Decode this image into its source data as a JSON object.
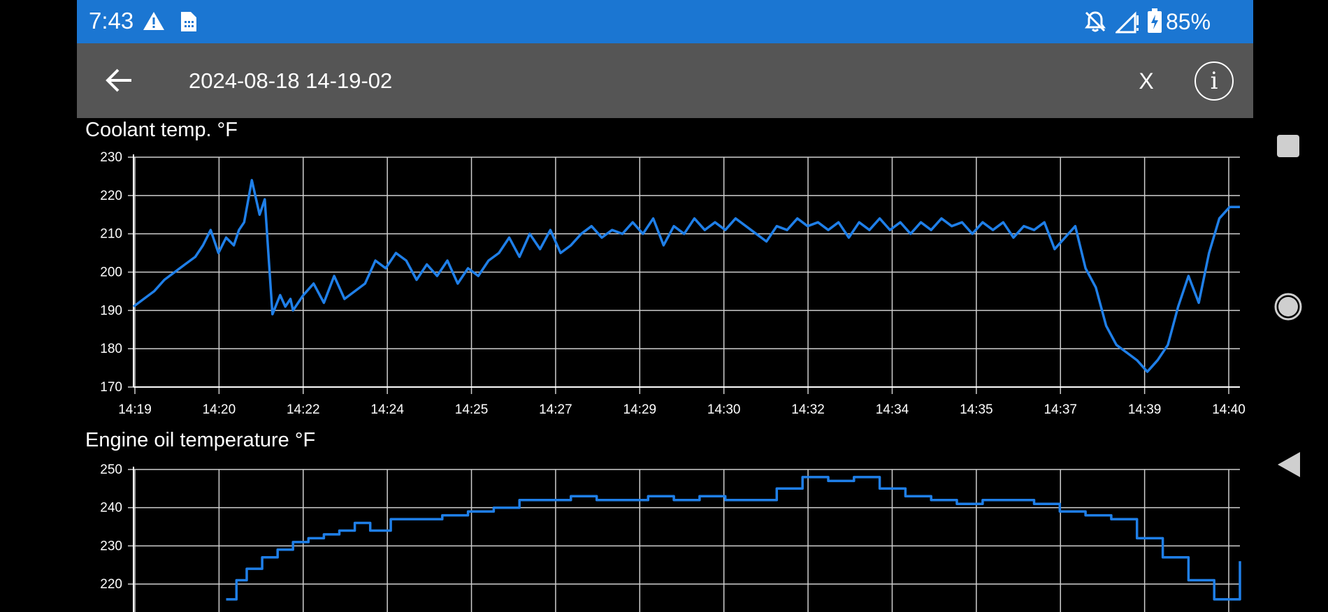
{
  "status_bar": {
    "time": "7:43",
    "battery_percent": "85%",
    "background_color": "#1b76d2",
    "icons": [
      "warning-icon",
      "sim-card-icon",
      "notifications-off-icon",
      "signal-no-data-icon",
      "battery-charging-icon"
    ]
  },
  "toolbar": {
    "title": "2024-08-18 14-19-02",
    "close_label": "X",
    "info_label": "i",
    "background_color": "#555555",
    "icons": [
      "back-arrow-icon",
      "info-icon"
    ]
  },
  "navigation_bar": {
    "icons": [
      "recents-square-icon",
      "home-circle-icon",
      "back-triangle-icon"
    ]
  },
  "charts": [
    {
      "title": "Coolant temp.  °F",
      "x_ticks": [
        "14:19",
        "14:20",
        "14:22",
        "14:24",
        "14:25",
        "14:27",
        "14:29",
        "14:30",
        "14:32",
        "14:34",
        "14:35",
        "14:37",
        "14:39",
        "14:40"
      ],
      "y_ticks": [
        "230",
        "220",
        "210",
        "200",
        "190",
        "180",
        "170"
      ]
    },
    {
      "title": "Engine oil temperature  °F",
      "y_ticks": [
        "250",
        "240",
        "230",
        "220"
      ]
    }
  ],
  "chart_data": [
    {
      "type": "line",
      "title": "Coolant temp.  °F",
      "xlabel": "",
      "ylabel": "",
      "x_unit": "minutes",
      "xlim": [
        0,
        21.5
      ],
      "ylim": [
        170,
        230
      ],
      "grid": true,
      "line_color": "#1f7fe8",
      "series": [
        {
          "x": [
            0.0,
            0.2,
            0.4,
            0.6,
            0.8,
            1.0,
            1.2,
            1.35,
            1.5,
            1.65,
            1.8,
            1.95,
            2.05,
            2.15,
            2.3,
            2.45,
            2.55,
            2.7,
            2.85,
            2.95,
            3.05,
            3.1,
            3.15,
            3.3,
            3.5,
            3.7,
            3.9,
            4.1,
            4.3,
            4.5,
            4.7,
            4.9,
            5.1,
            5.3,
            5.5,
            5.7,
            5.9,
            6.1,
            6.3,
            6.5,
            6.7,
            6.9,
            7.1,
            7.3,
            7.5,
            7.7,
            7.9,
            8.1,
            8.3,
            8.5,
            8.7,
            8.9,
            9.1,
            9.3,
            9.5,
            9.7,
            9.9,
            10.1,
            10.3,
            10.5,
            10.7,
            10.9,
            11.1,
            11.3,
            11.5,
            11.7,
            11.9,
            12.1,
            12.3,
            12.5,
            12.7,
            12.9,
            13.1,
            13.3,
            13.5,
            13.7,
            13.9,
            14.1,
            14.3,
            14.5,
            14.7,
            14.9,
            15.1,
            15.3,
            15.5,
            15.7,
            15.9,
            16.1,
            16.3,
            16.5,
            16.7,
            16.9,
            17.1,
            17.3,
            17.5,
            17.7,
            17.9,
            18.1,
            18.3,
            18.5,
            18.7,
            18.9,
            19.1,
            19.3,
            19.5,
            19.7,
            19.9,
            20.1,
            20.3,
            20.5,
            20.7,
            20.9,
            21.1,
            21.3,
            21.5
          ],
          "y": [
            191,
            193,
            195,
            198,
            200,
            202,
            204,
            207,
            211,
            205,
            209,
            207,
            211,
            213,
            224,
            215,
            219,
            189,
            194,
            191,
            193,
            190,
            191,
            194,
            197,
            192,
            199,
            193,
            195,
            197,
            203,
            201,
            205,
            203,
            198,
            202,
            199,
            203,
            197,
            201,
            199,
            203,
            205,
            209,
            204,
            210,
            206,
            211,
            205,
            207,
            210,
            212,
            209,
            211,
            210,
            213,
            210,
            214,
            207,
            212,
            210,
            214,
            211,
            213,
            211,
            214,
            212,
            210,
            208,
            212,
            211,
            214,
            212,
            213,
            211,
            213,
            209,
            213,
            211,
            214,
            211,
            213,
            210,
            213,
            211,
            214,
            212,
            213,
            210,
            213,
            211,
            213,
            209,
            212,
            211,
            213,
            206,
            209,
            212,
            201,
            196,
            186,
            181,
            179,
            177,
            174,
            177,
            181,
            191,
            199,
            192,
            205,
            214,
            217,
            217
          ],
          "values_note": "approximate"
        }
      ]
    },
    {
      "type": "line",
      "title": "Engine oil temperature  °F",
      "xlabel": "",
      "ylabel": "",
      "ylim": [
        215,
        250
      ],
      "grid": true,
      "line_color": "#1f7fe8",
      "series": [
        {
          "x": [
            1.8,
            2.0,
            2.2,
            2.5,
            2.8,
            3.1,
            3.4,
            3.7,
            4.0,
            4.3,
            4.6,
            5.0,
            5.5,
            6.0,
            6.5,
            7.0,
            7.5,
            8.0,
            8.5,
            9.0,
            9.5,
            10.0,
            10.5,
            11.0,
            11.5,
            12.0,
            12.5,
            13.0,
            13.5,
            14.0,
            14.5,
            15.0,
            15.5,
            16.0,
            16.5,
            17.0,
            17.5,
            18.0,
            18.5,
            19.0,
            19.5,
            20.0,
            20.5,
            21.0,
            21.5
          ],
          "y": [
            216,
            221,
            224,
            227,
            229,
            231,
            232,
            233,
            234,
            236,
            234,
            237,
            237,
            238,
            239,
            240,
            242,
            242,
            243,
            242,
            242,
            243,
            242,
            243,
            242,
            242,
            245,
            248,
            247,
            248,
            245,
            243,
            242,
            241,
            242,
            242,
            241,
            239,
            238,
            237,
            232,
            227,
            221,
            216,
            226
          ],
          "values_note": "approximate"
        }
      ]
    }
  ]
}
